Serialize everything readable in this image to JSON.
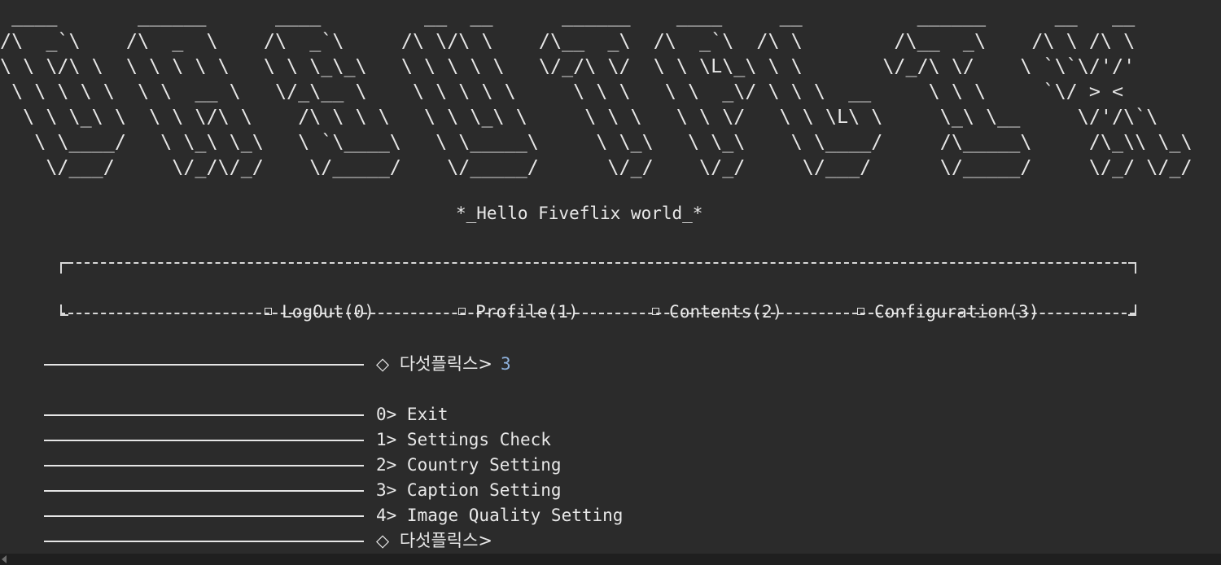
{
  "banner_art": " ____       ______      ____         __  __      ______    ____     __          ______      __   __\n/\\  _`\\    /\\  _  \\    /\\  _`\\     /\\ \\/\\ \\    /\\__  _\\  /\\  _`\\  /\\ \\        /\\__  _\\    /\\ \\ /\\ \\\n\\ \\ \\/\\ \\  \\ \\ \\ \\ \\   \\ \\ \\_\\_\\   \\ \\ \\ \\ \\   \\/_/\\ \\/  \\ \\ \\L\\_\\ \\ \\       \\/_/\\ \\/    \\ `\\`\\/'/'\n \\ \\ \\ \\ \\  \\ \\  __ \\   \\/_\\__ \\    \\ \\ \\ \\ \\     \\ \\ \\   \\ \\  _\\/ \\ \\ \\  __     \\ \\ \\     `\\/ > <\n  \\ \\ \\_\\ \\  \\ \\ \\/\\ \\    /\\ \\ \\ \\   \\ \\ \\_\\ \\     \\ \\ \\   \\ \\ \\/   \\ \\ \\L\\ \\     \\_\\ \\__     \\/'/\\`\\\n   \\ \\____/   \\ \\_\\ \\_\\   \\ `\\____\\   \\ \\_____\\     \\ \\_\\   \\ \\_\\    \\ \\____/     /\\_____\\     /\\_\\\\ \\_\\\n    \\/___/     \\/_/\\/_/    \\/_____/    \\/_____/      \\/_/    \\/_/     \\/___/      \\/_____/     \\/_/ \\/_/",
  "greeting": "*_Hello Fiveflix world_*",
  "menu": [
    {
      "label": "LogOut(0)"
    },
    {
      "label": "Profile(1)"
    },
    {
      "label": "Contents(2)"
    },
    {
      "label": "Configuration(3)"
    }
  ],
  "prompt": {
    "glyph": "◇",
    "label": "다섯플릭스>",
    "input": "3"
  },
  "options": [
    {
      "text": "0> Exit"
    },
    {
      "text": "1> Settings Check"
    },
    {
      "text": "2> Country Setting"
    },
    {
      "text": "3> Caption Setting"
    },
    {
      "text": "4> Image Quality Setting"
    }
  ],
  "next_prompt": {
    "glyph": "◇",
    "label": "다섯플릭스>"
  },
  "colors": {
    "background": "#2b2b2b",
    "text": "#e8e8e8",
    "input": "#8fb2dd"
  }
}
